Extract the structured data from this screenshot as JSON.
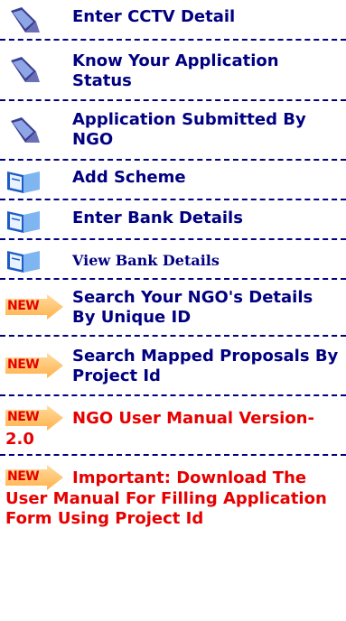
{
  "menu": {
    "items": [
      {
        "label": "Enter CCTV Detail"
      },
      {
        "label": "Know Your Application Status"
      },
      {
        "label": "Application Submitted By NGO"
      },
      {
        "label": "Add Scheme"
      },
      {
        "label": "Enter Bank Details"
      },
      {
        "label": "View Bank Details"
      },
      {
        "label": "Search Your NGO's Details By Unique ID",
        "badge": "NEW"
      },
      {
        "label": "Search Mapped Proposals By Project Id",
        "badge": "NEW"
      }
    ],
    "red_items": [
      {
        "label_line1": "NGO User Manual Version-",
        "label_line2": "2.0",
        "badge": "NEW"
      },
      {
        "label_line1": "Important: Download The",
        "label_rest": "User Manual For Filling Application Form Using Project Id",
        "badge": "NEW"
      }
    ]
  },
  "colors": {
    "link": "#000080",
    "highlight": "#e60000",
    "divider": "#000080"
  }
}
